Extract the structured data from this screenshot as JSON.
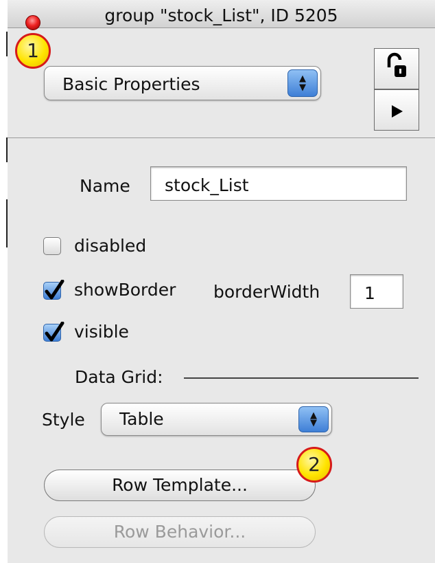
{
  "window": {
    "title": "group \"stock_List\", ID 5205"
  },
  "callouts": {
    "one": "1",
    "two": "2"
  },
  "pane_select": {
    "value": "Basic Properties"
  },
  "name": {
    "label": "Name",
    "value": "stock_List"
  },
  "checkboxes": {
    "disabled": {
      "label": "disabled",
      "checked": false
    },
    "show_border": {
      "label": "showBorder",
      "checked": true
    },
    "visible": {
      "label": "visible",
      "checked": true
    }
  },
  "border_width": {
    "label": "borderWidth",
    "value": "1"
  },
  "data_grid": {
    "heading": "Data Grid:"
  },
  "style": {
    "label": "Style",
    "value": "Table"
  },
  "buttons": {
    "row_template": "Row Template...",
    "row_behavior": "Row Behavior..."
  },
  "icons": {
    "close": "close-icon",
    "lock": "unlock-icon",
    "arrow": "play-arrow-icon"
  },
  "colors": {
    "accent": "#3f7fd6",
    "close": "#e22222",
    "callout_fill": "#ffe400",
    "callout_border": "#d61a1a"
  }
}
